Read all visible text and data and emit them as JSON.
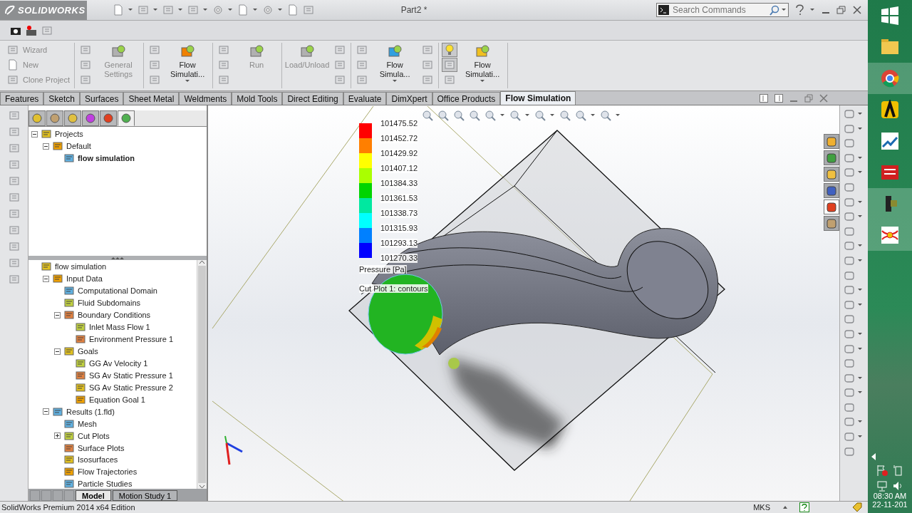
{
  "title_bar": {
    "app_name": "SOLIDWORKS",
    "document": "Part2 *",
    "search": {
      "placeholder": "Search Commands"
    }
  },
  "command_groups": [
    {
      "items": [
        {
          "kind": "small",
          "label": "Wizard"
        },
        {
          "kind": "small",
          "label": "New"
        },
        {
          "kind": "small",
          "label": "Clone Project"
        }
      ]
    },
    {
      "items": [
        {
          "kind": "icons",
          "buttons": [
            {
              "pressed": false
            },
            {
              "pressed": false
            },
            {
              "pressed": false
            }
          ]
        },
        {
          "kind": "large",
          "label": "General Settings",
          "dropdown": false
        }
      ]
    },
    {
      "items": [
        {
          "kind": "icons",
          "buttons": [
            {
              "pressed": false
            },
            {
              "pressed": false
            },
            {
              "pressed": false
            }
          ]
        },
        {
          "kind": "large",
          "label": "Flow Simulati...",
          "dropdown": true
        }
      ]
    },
    {
      "items": [
        {
          "kind": "icons",
          "buttons": [
            {
              "pressed": false
            },
            {
              "pressed": false
            },
            {
              "pressed": false
            }
          ]
        },
        {
          "kind": "large",
          "label": "Run",
          "dropdown": false
        }
      ]
    },
    {
      "items": [
        {
          "kind": "large",
          "label": "Load/Unload",
          "dropdown": false
        },
        {
          "kind": "icons",
          "buttons": [
            {
              "pressed": false
            },
            {
              "pressed": false
            },
            {
              "pressed": false
            }
          ]
        }
      ]
    },
    {
      "items": [
        {
          "kind": "icons",
          "buttons": [
            {
              "pressed": false
            },
            {
              "pressed": false
            },
            {
              "pressed": false
            }
          ]
        },
        {
          "kind": "large",
          "label": "Flow Simula...",
          "dropdown": true
        },
        {
          "kind": "icons",
          "buttons": [
            {
              "pressed": false
            },
            {
              "pressed": false
            },
            {
              "pressed": false
            }
          ]
        }
      ]
    },
    {
      "items": [
        {
          "kind": "icons",
          "buttons": [
            {
              "pressed": true
            },
            {
              "pressed": true
            },
            {
              "pressed": false
            }
          ]
        },
        {
          "kind": "large",
          "label": "Flow Simulati...",
          "dropdown": true
        }
      ]
    }
  ],
  "tabs": [
    {
      "label": "Features",
      "selected": false
    },
    {
      "label": "Sketch",
      "selected": false
    },
    {
      "label": "Surfaces",
      "selected": false
    },
    {
      "label": "Sheet Metal",
      "selected": false
    },
    {
      "label": "Weldments",
      "selected": false
    },
    {
      "label": "Mold Tools",
      "selected": false
    },
    {
      "label": "Direct Editing",
      "selected": false
    },
    {
      "label": "Evaluate",
      "selected": false
    },
    {
      "label": "DimXpert",
      "selected": false
    },
    {
      "label": "Office Products",
      "selected": false
    },
    {
      "label": "Flow Simulation",
      "selected": true
    }
  ],
  "panel_tabs": [
    {
      "selected": false
    },
    {
      "selected": false
    },
    {
      "selected": false
    },
    {
      "selected": false
    },
    {
      "selected": false
    },
    {
      "selected": true
    }
  ],
  "project_tree": [
    {
      "label": "Projects",
      "active": false,
      "expanded": true,
      "children": [
        {
          "label": "Default",
          "active": false,
          "expanded": true,
          "children": [
            {
              "label": "flow simulation",
              "active": true
            }
          ]
        }
      ]
    }
  ],
  "analysis_tree": [
    {
      "label": "flow simulation",
      "active": false,
      "children": [
        {
          "label": "Input Data",
          "active": false,
          "expanded": true,
          "children": [
            {
              "label": "Computational Domain",
              "active": false
            },
            {
              "label": "Fluid Subdomains",
              "active": false
            },
            {
              "label": "Boundary Conditions",
              "active": false,
              "expanded": true,
              "children": [
                {
                  "label": "Inlet Mass Flow 1",
                  "active": false
                },
                {
                  "label": "Environment Pressure 1",
                  "active": false
                }
              ]
            },
            {
              "label": "Goals",
              "active": false,
              "expanded": true,
              "children": [
                {
                  "label": "GG Av Velocity 1",
                  "active": false
                },
                {
                  "label": "SG Av Static Pressure 1",
                  "active": false
                },
                {
                  "label": "SG Av Static Pressure 2",
                  "active": false
                },
                {
                  "label": "Equation Goal 1",
                  "active": false
                }
              ]
            }
          ]
        },
        {
          "label": "Results (1.fld)",
          "active": false,
          "expanded": true,
          "children": [
            {
              "label": "Mesh",
              "active": false
            },
            {
              "label": "Cut Plots",
              "active": false,
              "expanded": false
            },
            {
              "label": "Surface Plots",
              "active": false
            },
            {
              "label": "Isosurfaces",
              "active": false
            },
            {
              "label": "Flow Trajectories",
              "active": false
            },
            {
              "label": "Particle Studies",
              "active": false
            }
          ]
        }
      ]
    }
  ],
  "bottom_tabs": [
    {
      "label": "Model",
      "selected": true
    },
    {
      "label": "Motion Study 1",
      "selected": false
    }
  ],
  "legend": {
    "values": [
      "101475.52",
      "101452.72",
      "101429.92",
      "101407.12",
      "101384.33",
      "101361.53",
      "101338.73",
      "101315.93",
      "101293.13",
      "101270.33"
    ],
    "bands": [
      {
        "color": "#ff0000"
      },
      {
        "color": "#ff7f00"
      },
      {
        "color": "#ffff00"
      },
      {
        "color": "#aaff00"
      },
      {
        "color": "#00d400"
      },
      {
        "color": "#00e8a0"
      },
      {
        "color": "#00ffff"
      },
      {
        "color": "#0080ff"
      },
      {
        "color": "#0000ff"
      }
    ],
    "title": "Pressure [Pa]",
    "caption": "Cut Plot 1: contours"
  },
  "task_pane_tabs": [
    {
      "selected": false
    },
    {
      "selected": false
    },
    {
      "selected": false
    },
    {
      "selected": false
    },
    {
      "selected": true
    },
    {
      "selected": false
    }
  ],
  "status_bar": {
    "text": "SolidWorks Premium 2014 x64 Edition",
    "units": "MKS"
  },
  "taskbar": {
    "apps": [
      {
        "selected": false
      },
      {
        "selected": true
      },
      {
        "selected": false
      },
      {
        "selected": false
      },
      {
        "selected": false
      },
      {
        "selected": true
      },
      {
        "selected": true
      }
    ],
    "time": "08:30 AM",
    "date": "22-11-201"
  }
}
